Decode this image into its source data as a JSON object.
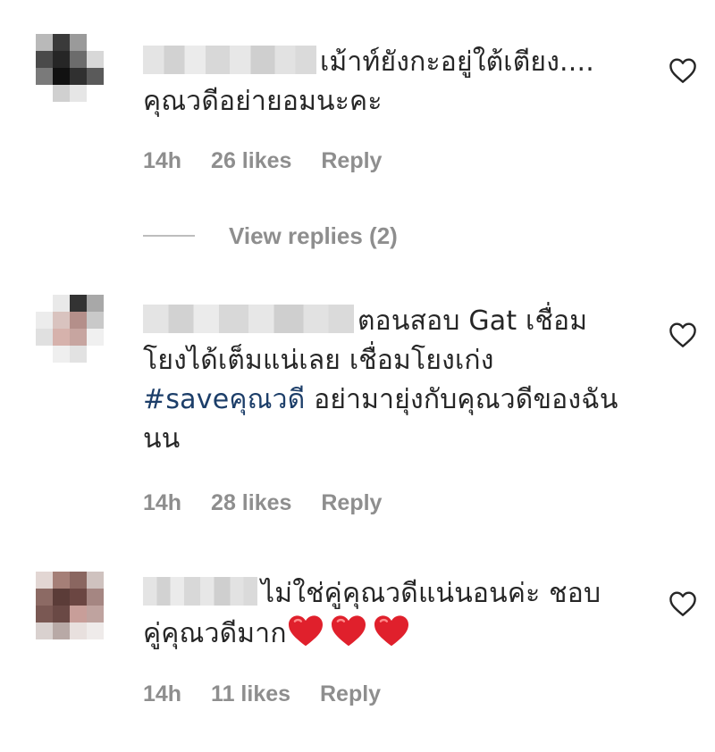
{
  "comments": [
    {
      "text_lines": [
        "เม้าท์ยังกะอยู่ใต้เตียง....",
        "คุณวดีอย่ายอมนะคะ"
      ],
      "time": "14h",
      "likes": "26 likes",
      "reply": "Reply"
    },
    {
      "text_lines": [
        "ตอนสอบ Gat เชื่อม",
        "โยงได้เต็มแน่เลย เชื่อมโยงเก่ง",
        "อย่ามายุ่งกับคุณวดีของฉัน",
        "นน"
      ],
      "hashtag": "#saveคุณวดี",
      "time": "14h",
      "likes": "28 likes",
      "reply": "Reply"
    },
    {
      "text_lines": [
        "ไม่ใช่คู่คุณวดีแน่นอนค่ะ ชอบ",
        "คู่คุณวดีมาก"
      ],
      "time": "14h",
      "likes": "11 likes",
      "reply": "Reply"
    }
  ],
  "view_replies": "View replies (2)",
  "colors": {
    "hashtag": "#1c3e69",
    "meta": "#8e8e8e",
    "heart_emoji": "#e0202c"
  },
  "icons": [
    "heart-outline-icon",
    "red-heart-emoji"
  ]
}
